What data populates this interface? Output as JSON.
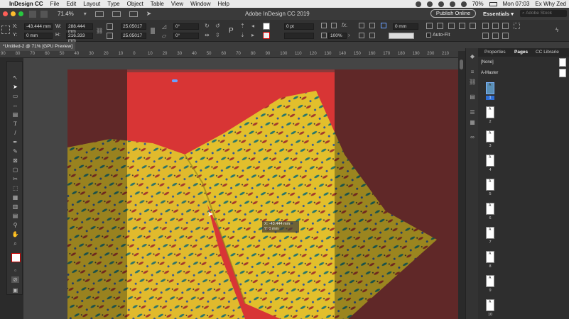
{
  "menubar": {
    "app": "InDesign CC",
    "items": [
      "File",
      "Edit",
      "Layout",
      "Type",
      "Object",
      "Table",
      "View",
      "Window",
      "Help"
    ],
    "battery": "70%",
    "clock": "Mon 07:03",
    "user": "Ex Why Zed"
  },
  "appbar": {
    "zoom": "71.4%",
    "title": "Adobe InDesign CC 2019",
    "publish_label": "Publish Online",
    "essentials_label": "Essentials",
    "search_placeholder": "Adobe Stock"
  },
  "control": {
    "x_label": "X:",
    "y_label": "Y:",
    "w_label": "W:",
    "h_label": "H:",
    "x_value": "-43.444 mm",
    "y_value": "0 mm",
    "w_value": "288.444 mm",
    "h_value": "216.333 mm",
    "scale_x": "25.05017",
    "scale_y": "25.05017",
    "rotate": "0°",
    "shear": "0°",
    "stroke_weight": "0 pt",
    "gap": "0 mm",
    "opacity": "100%",
    "autofit_label": "Auto-Fit"
  },
  "doc_tab": "*Untitled-2 @ 71% [GPU Preview]",
  "ruler": [
    "90",
    "80",
    "70",
    "60",
    "50",
    "40",
    "30",
    "20",
    "10",
    "0",
    "10",
    "20",
    "30",
    "40",
    "50",
    "60",
    "70",
    "80",
    "90",
    "100",
    "110",
    "120",
    "130",
    "140",
    "150",
    "160",
    "170",
    "180",
    "190",
    "200",
    "210"
  ],
  "measure": {
    "x": "X: -43.444 mm",
    "y": "Y: 0 mm"
  },
  "panel": {
    "tabs": [
      "Properties",
      "Pages",
      "CC Librarie"
    ],
    "active_tab": "Pages",
    "none_label": "[None]",
    "master_label": "A-Master",
    "page_letter": "A",
    "pages": [
      "1",
      "2",
      "3",
      "4",
      "5",
      "6",
      "7",
      "8",
      "9",
      "10"
    ],
    "selected_page": "1"
  },
  "colors": {
    "canvas": "#454545",
    "page_red": "#d83535",
    "image_overlay": "#8a3a3a",
    "photo_yellow": "#e2c62c",
    "selection_blue": "#2f6fd6"
  }
}
